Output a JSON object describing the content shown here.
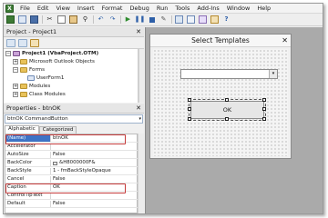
{
  "menu": {
    "app_icon": "excel-app-icon",
    "items": [
      "File",
      "Edit",
      "View",
      "Insert",
      "Format",
      "Debug",
      "Run",
      "Tools",
      "Add-Ins",
      "Window",
      "Help"
    ]
  },
  "toolbar": {
    "icons": [
      "excel-icon",
      "insert-userform-icon",
      "save-icon",
      "cut-icon",
      "copy-icon",
      "paste-icon",
      "find-icon",
      "undo-icon",
      "redo-icon",
      "run-icon",
      "break-icon",
      "reset-icon",
      "design-mode-icon",
      "project-explorer-icon",
      "properties-icon",
      "object-browser-icon",
      "toolbox-icon",
      "help-icon"
    ]
  },
  "project_pane": {
    "title": "Project - Project1",
    "close_glyph": "✕",
    "tree": [
      {
        "label": "Project1 (VbaProject.OTM)",
        "level": 0,
        "expander": "−",
        "icon": "project-icon",
        "bold": true
      },
      {
        "label": "Microsoft Outlook Objects",
        "level": 1,
        "expander": "+",
        "icon": "folder-icon"
      },
      {
        "label": "Forms",
        "level": 1,
        "expander": "−",
        "icon": "folder-icon"
      },
      {
        "label": "UserForm1",
        "level": 2,
        "expander": "",
        "icon": "form-icon"
      },
      {
        "label": "Modules",
        "level": 1,
        "expander": "+",
        "icon": "folder-icon"
      },
      {
        "label": "Class Modules",
        "level": 1,
        "expander": "+",
        "icon": "folder-icon"
      }
    ]
  },
  "properties_pane": {
    "title": "Properties - btnOK",
    "close_glyph": "✕",
    "object_selector": "btnOK CommandButton",
    "tabs": [
      "Alphabetic",
      "Categorized"
    ],
    "active_tab": "Alphabetic",
    "rows": [
      {
        "name": "(Name)",
        "value": "btnOK",
        "selected": true
      },
      {
        "name": "Accelerator",
        "value": ""
      },
      {
        "name": "AutoSize",
        "value": "False"
      },
      {
        "name": "BackColor",
        "value": "&H8000000F&",
        "swatch": "#e8e8e8"
      },
      {
        "name": "BackStyle",
        "value": "1 - fmBackStyleOpaque"
      },
      {
        "name": "Cancel",
        "value": "False"
      },
      {
        "name": "Caption",
        "value": "OK"
      },
      {
        "name": "ControlTipText",
        "value": ""
      },
      {
        "name": "Default",
        "value": "False"
      }
    ]
  },
  "designer": {
    "form_title": "Select Templates",
    "close_glyph": "✕",
    "combo_arrow": "▾",
    "ok_button_label": "OK"
  },
  "colors": {
    "highlight": "#c43a3a",
    "selection": "#3d73c6"
  }
}
